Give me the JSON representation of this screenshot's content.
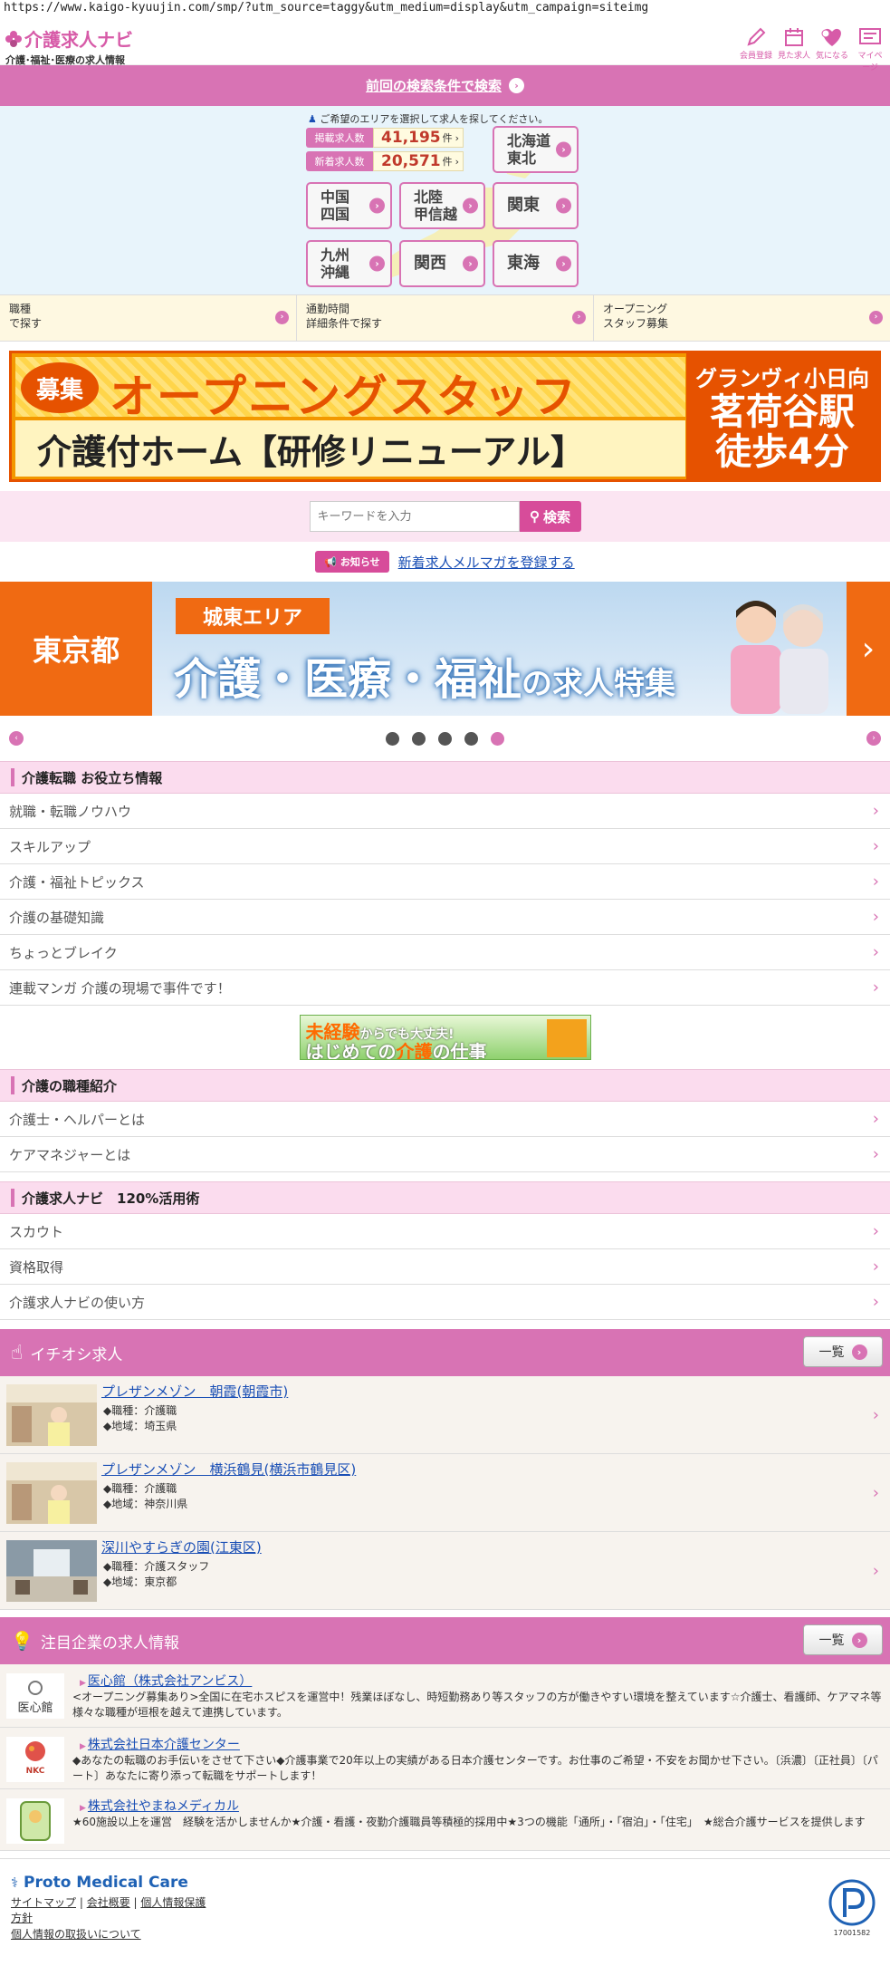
{
  "url": "https://www.kaigo-kyuujin.com/smp/?utm_source=taggy&utm_medium=display&utm_campaign=siteimg",
  "header": {
    "logo_main": "介護求人ナビ",
    "logo_sub": "介護･福祉･医療の求人情報",
    "icons": [
      {
        "label": "会員登録",
        "icon": "pencil-icon"
      },
      {
        "label": "見た求人",
        "icon": "calendar-icon"
      },
      {
        "label": "気になる",
        "icon": "heart-icon"
      },
      {
        "label": "マイページ",
        "icon": "mypage-icon"
      }
    ]
  },
  "prev_search": "前回の検索条件で検索",
  "map": {
    "hint": "ご希望のエリアを選択して求人を探してください。",
    "counts": [
      {
        "label": "掲載求人数",
        "value": "41,195",
        "unit": "件"
      },
      {
        "label": "新着求人数",
        "value": "20,571",
        "unit": "件"
      }
    ],
    "regions": [
      "北海道\n東北",
      "中国\n四国",
      "北陸\n甲信越",
      "関東",
      "九州\n沖縄",
      "関西",
      "東海"
    ]
  },
  "subnav": [
    "職種\nで探す",
    "通勤時間\n詳細条件で探す",
    "オープニング\nスタッフ募集"
  ],
  "banner1": {
    "badge": "募集",
    "main": "オープニングスタッフ",
    "sub": "介護付ホーム【研修リニューアル】",
    "right1": "グランヴィ小日向",
    "right2": "茗荷谷駅",
    "right3": "徒歩4分"
  },
  "search": {
    "placeholder": "キーワードを入力",
    "button": "検索"
  },
  "news": {
    "badge": "お知らせ",
    "link": "新着求人メルマガを登録する"
  },
  "banner2": {
    "left": "東京都",
    "tag": "城東エリア",
    "main": "介護・医療・福祉",
    "main_suffix": "の求人特集"
  },
  "carousel": {
    "dots": 5,
    "active": 4
  },
  "section1": {
    "title": "介護転職 お役立ち情報",
    "items": [
      "就職・転職ノウハウ",
      "スキルアップ",
      "介護・福祉トピックス",
      "介護の基礎知識",
      "ちょっとブレイク",
      "連載マンガ 介護の現場で事件です！"
    ]
  },
  "mini_banner": {
    "t1a": "未経験",
    "t1b": "からでも大丈夫!",
    "t2a": "はじめての",
    "t2b": "介護",
    "t2c": "の仕事"
  },
  "section2": {
    "title": "介護の職種紹介",
    "items": [
      "介護士・ヘルパーとは",
      "ケアマネジャーとは"
    ]
  },
  "section3": {
    "title": "介護求人ナビ　120%活用術",
    "items": [
      "スカウト",
      "資格取得",
      "介護求人ナビの使い方"
    ]
  },
  "pickup": {
    "title": "イチオシ求人",
    "list_button": "一覧",
    "items": [
      {
        "title": "プレザンメゾン　朝霞(朝霞市)",
        "job": "◆職種：介護職",
        "area": "◆地域：埼玉県"
      },
      {
        "title": "プレザンメゾン　横浜鶴見(横浜市鶴見区)",
        "job": "◆職種：介護職",
        "area": "◆地域：神奈川県"
      },
      {
        "title": "深川やすらぎの園(江東区)",
        "job": "◆職種：介護スタッフ",
        "area": "◆地域：東京都"
      }
    ]
  },
  "companies": {
    "title": "注目企業の求人情報",
    "list_button": "一覧",
    "items": [
      {
        "name": "医心館（株式会社アンビス）",
        "logo_text": "医心館",
        "desc": "<オープニング募集あり>全国に在宅ホスピスを運営中！残業ほぼなし、時短勤務あり等スタッフの方が働きやすい環境を整えています☆介護士、看護師、ケアマネ等様々な職種が垣根を越えて連携しています。"
      },
      {
        "name": "株式会社日本介護センター",
        "logo_text": "NKC",
        "desc": "◆あなたの転職のお手伝いをさせて下さい◆介護事業で20年以上の実績がある日本介護センターです。お仕事のご希望・不安をお聞かせ下さい。〔浜濃〕〔正社員〕〔パート〕あなたに寄り添って転職をサポートします！"
      },
      {
        "name": "株式会社やまねメディカル",
        "logo_text": "",
        "desc": "★60施設以上を運営　経験を活かしませんか★介護・看護・夜勤介護職員等積極的採用中★3つの機能「通所」・「宿泊」・「住宅」　★総合介護サービスを提供します"
      }
    ]
  },
  "footer": {
    "brand": "Proto Medical Care",
    "links": [
      "サイトマップ",
      "会社概要",
      "個人情報保護"
    ],
    "link_cont": "方針",
    "link2": "個人情報の取扱いについて",
    "pmark_code": "17001582"
  },
  "colors": {
    "pink": "#d873b4",
    "orange": "#f06a12",
    "link": "#1a4fb5"
  }
}
